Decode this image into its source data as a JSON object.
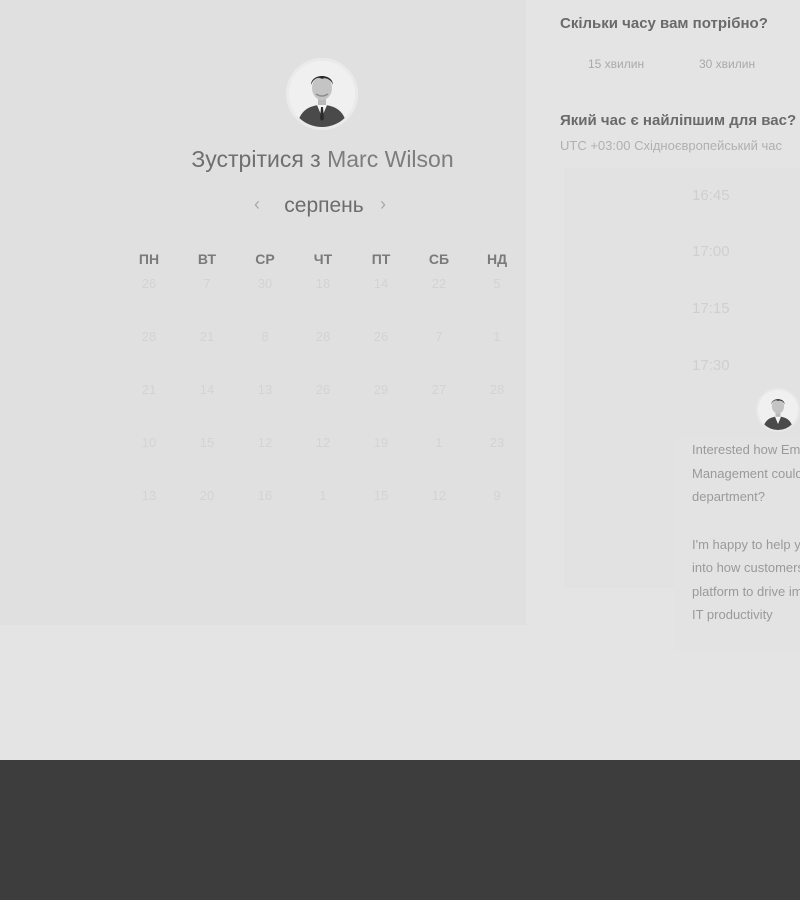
{
  "booking": {
    "title_prefix": "Зустрітися з",
    "host_name": "Marc Wilson",
    "month": "серпень",
    "prev_icon": "chevron-left-icon",
    "next_icon": "chevron-right-icon",
    "weekdays": [
      "ПН",
      "ВТ",
      "СР",
      "ЧТ",
      "ПТ",
      "СБ",
      "НД"
    ],
    "weeks": [
      [
        "26",
        "7",
        "30",
        "18",
        "14",
        "22",
        "5"
      ],
      [
        "28",
        "21",
        "8",
        "28",
        "26",
        "7",
        "1"
      ],
      [
        "21",
        "14",
        "13",
        "26",
        "29",
        "27",
        "28"
      ],
      [
        "10",
        "15",
        "12",
        "12",
        "19",
        "1",
        "23"
      ],
      [
        "13",
        "20",
        "16",
        "1",
        "15",
        "12",
        "9"
      ]
    ]
  },
  "duration": {
    "question": "Скільки часу вам потрібно?",
    "options": [
      "15 хвилин",
      "30 хвилин"
    ]
  },
  "time": {
    "question": "Який час є найліпшим для вас?",
    "timezone": "UTC +03:00 Східноєвропейський час",
    "slots": [
      "16:45",
      "17:00",
      "17:15",
      "17:30"
    ]
  },
  "chat": {
    "message1": "Interested how Employee Management could help your department?",
    "message2": "I'm happy to help you get insight into how customers use our platform to drive improvement in IT productivity"
  },
  "colors": {
    "footer": "#3d3d3d",
    "background": "#e4e4e4"
  }
}
